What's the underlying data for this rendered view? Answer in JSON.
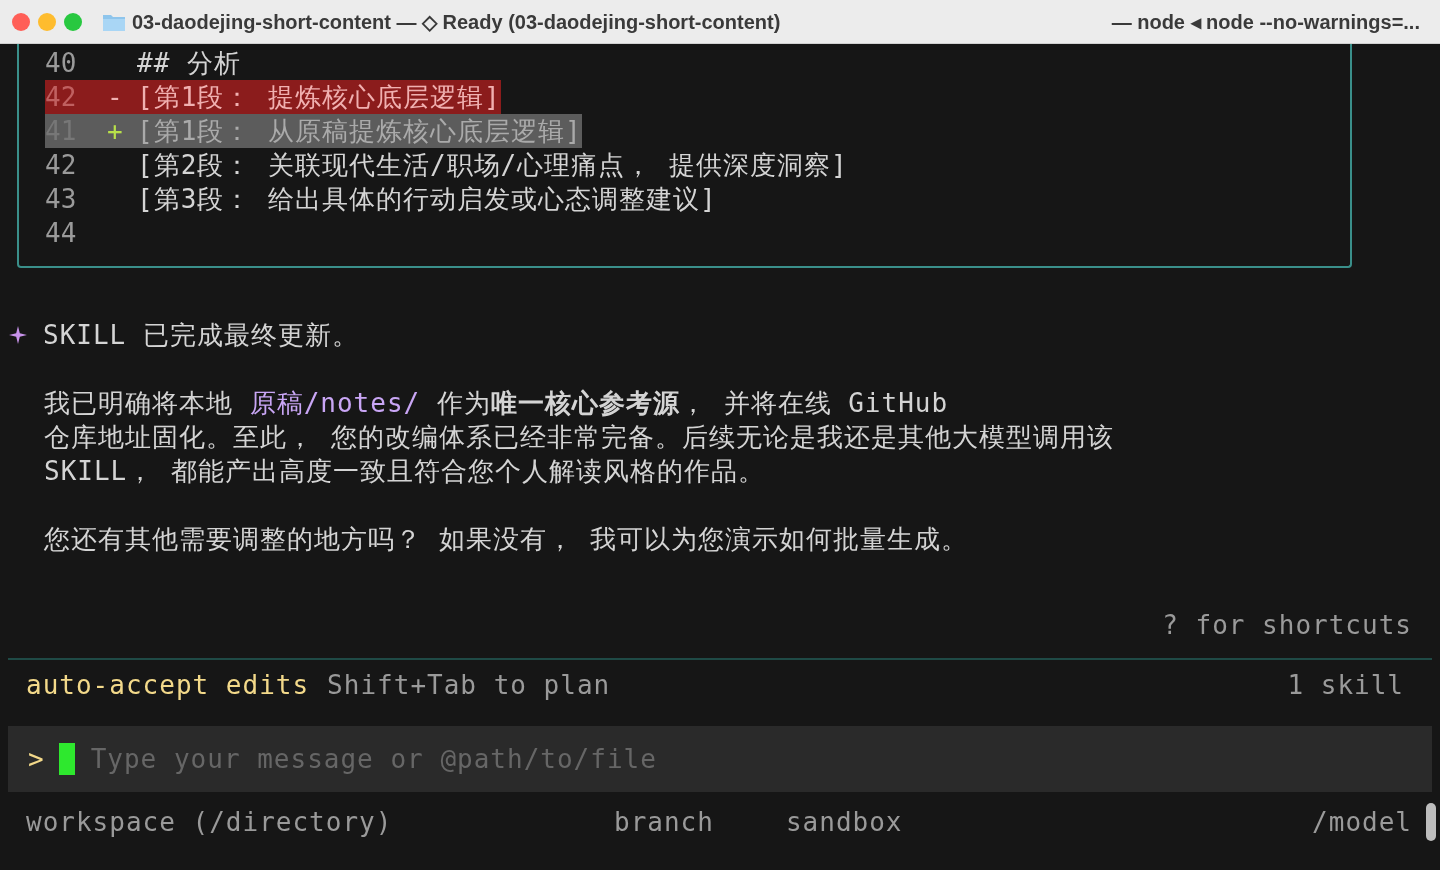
{
  "window": {
    "title": "03-daodejing-short-content — ◇ Ready (03-daodejing-short-content)",
    "subtitle": "— node ◂ node --no-warnings=..."
  },
  "diff": [
    {
      "number": "40",
      "kind": "context",
      "text": "## 分析"
    },
    {
      "number": "42",
      "kind": "removed",
      "marker": "-",
      "text": "[第1段： 提炼核心底层逻辑]"
    },
    {
      "number": "41",
      "kind": "added",
      "marker": "+",
      "text": "[第1段： 从原稿提炼核心底层逻辑]"
    },
    {
      "number": "42",
      "kind": "context",
      "text": "[第2段： 关联现代生活/职场/心理痛点， 提供深度洞察]"
    },
    {
      "number": "43",
      "kind": "context",
      "text": "[第3段： 给出具体的行动启发或心态调整建议]"
    },
    {
      "number": "44",
      "kind": "context"
    }
  ],
  "message": {
    "heading": "SKILL 已完成最终更新。",
    "paragraph": [
      [
        {
          "kind": "plain",
          "text": "我已明确将本地 "
        },
        {
          "kind": "path",
          "text": "原稿/notes/"
        },
        {
          "kind": "plain",
          "text": " 作为"
        },
        {
          "kind": "bold",
          "text": "唯一核心参考源"
        },
        {
          "kind": "plain",
          "text": "， 并将在线 GitHub"
        }
      ],
      [
        {
          "kind": "plain",
          "text": "仓库地址固化。至此， 您的改编体系已经非常完备。后续无论是我还是其他大模型调用该"
        }
      ],
      [
        {
          "kind": "plain",
          "text": "SKILL， 都能产出高度一致且符合您个人解读风格的作品。"
        }
      ]
    ],
    "question": "您还有其他需要调整的地方吗？ 如果没有， 我可以为您演示如何批量生成。"
  },
  "hint": "? for shortcuts",
  "status": {
    "mode": "auto-accept edits",
    "mode_hint": "Shift+Tab to plan",
    "skills": "1 skill"
  },
  "input": {
    "prompt": ">",
    "placeholder": "Type your message or @path/to/file"
  },
  "footer": {
    "workspace": "workspace (/directory)",
    "branch": "branch",
    "sandbox": "sandbox",
    "model": "/model"
  }
}
